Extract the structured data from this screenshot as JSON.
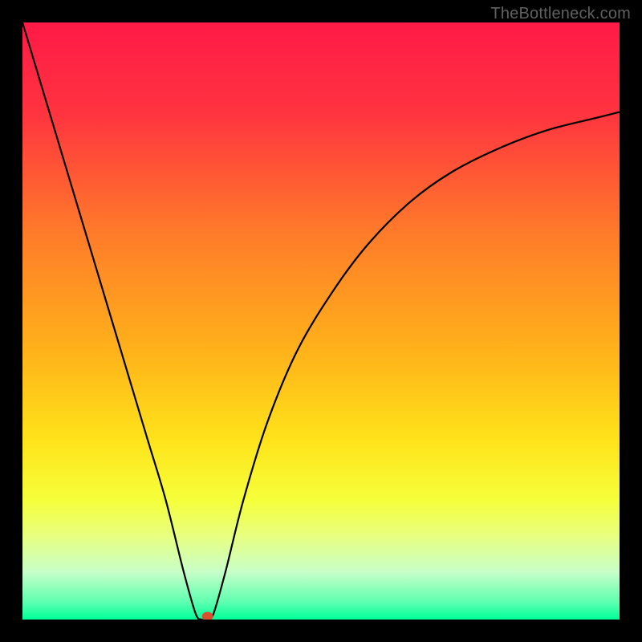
{
  "watermark": "TheBottleneck.com",
  "chart_data": {
    "type": "line",
    "title": "",
    "xlabel": "",
    "ylabel": "",
    "xlim": [
      0,
      100
    ],
    "ylim": [
      0,
      100
    ],
    "background_gradient": {
      "stops": [
        {
          "offset": 0,
          "color": "#ff1a47"
        },
        {
          "offset": 15,
          "color": "#ff3340"
        },
        {
          "offset": 35,
          "color": "#ff7a2a"
        },
        {
          "offset": 55,
          "color": "#ffb21a"
        },
        {
          "offset": 70,
          "color": "#ffe31a"
        },
        {
          "offset": 80,
          "color": "#f5ff3a"
        },
        {
          "offset": 86,
          "color": "#e8ff80"
        },
        {
          "offset": 92,
          "color": "#c8ffc8"
        },
        {
          "offset": 97,
          "color": "#60ffb0"
        },
        {
          "offset": 100,
          "color": "#00ff99"
        }
      ]
    },
    "series": [
      {
        "name": "bottleneck-curve",
        "color": "#000000",
        "points": [
          {
            "x": 0,
            "y": 100
          },
          {
            "x": 3,
            "y": 90
          },
          {
            "x": 6,
            "y": 80
          },
          {
            "x": 9,
            "y": 70
          },
          {
            "x": 12,
            "y": 60
          },
          {
            "x": 15,
            "y": 50
          },
          {
            "x": 18,
            "y": 40
          },
          {
            "x": 21,
            "y": 30
          },
          {
            "x": 24,
            "y": 20
          },
          {
            "x": 27,
            "y": 8
          },
          {
            "x": 29,
            "y": 1
          },
          {
            "x": 30,
            "y": 0
          },
          {
            "x": 31,
            "y": 0
          },
          {
            "x": 32,
            "y": 1
          },
          {
            "x": 34,
            "y": 8
          },
          {
            "x": 37,
            "y": 20
          },
          {
            "x": 41,
            "y": 33
          },
          {
            "x": 46,
            "y": 45
          },
          {
            "x": 52,
            "y": 55
          },
          {
            "x": 58,
            "y": 63
          },
          {
            "x": 65,
            "y": 70
          },
          {
            "x": 72,
            "y": 75
          },
          {
            "x": 80,
            "y": 79
          },
          {
            "x": 88,
            "y": 82
          },
          {
            "x": 96,
            "y": 84
          },
          {
            "x": 100,
            "y": 85
          }
        ]
      }
    ],
    "marker": {
      "x": 31,
      "y": 0,
      "color": "#d95030"
    }
  }
}
